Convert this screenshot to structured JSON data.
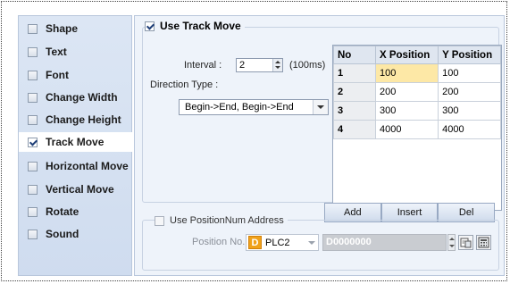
{
  "sidebar": {
    "items": [
      {
        "label": "Shape",
        "checked": false
      },
      {
        "label": "Text",
        "checked": false
      },
      {
        "label": "Font",
        "checked": false
      },
      {
        "label": "Change Width",
        "checked": false
      },
      {
        "label": "Change Height",
        "checked": false
      },
      {
        "label": "Track Move",
        "checked": true
      },
      {
        "label": "Horizontal Move",
        "checked": false
      },
      {
        "label": "Vertical Move",
        "checked": false
      },
      {
        "label": "Rotate",
        "checked": false
      },
      {
        "label": "Sound",
        "checked": false
      }
    ]
  },
  "track_move": {
    "group_label": "Use Track Move",
    "enabled": true,
    "interval_label": "Interval :",
    "interval_value": "2",
    "interval_unit": "(100ms)",
    "direction_label": "Direction Type :",
    "direction_value": "Begin->End, Begin->End",
    "table": {
      "headers": [
        "No",
        "X Position",
        "Y Position"
      ],
      "rows": [
        {
          "no": "1",
          "x": "100",
          "y": "100"
        },
        {
          "no": "2",
          "x": "200",
          "y": "200"
        },
        {
          "no": "3",
          "x": "300",
          "y": "300"
        },
        {
          "no": "4",
          "x": "4000",
          "y": "4000"
        }
      ]
    },
    "buttons": {
      "add": "Add",
      "insert": "Insert",
      "del": "Del"
    }
  },
  "position_num": {
    "group_label": "Use PositionNum Address",
    "enabled": false,
    "position_label": "Position No.",
    "device_icon": "D",
    "device_value": "PLC2",
    "address_value": "D0000000"
  }
}
